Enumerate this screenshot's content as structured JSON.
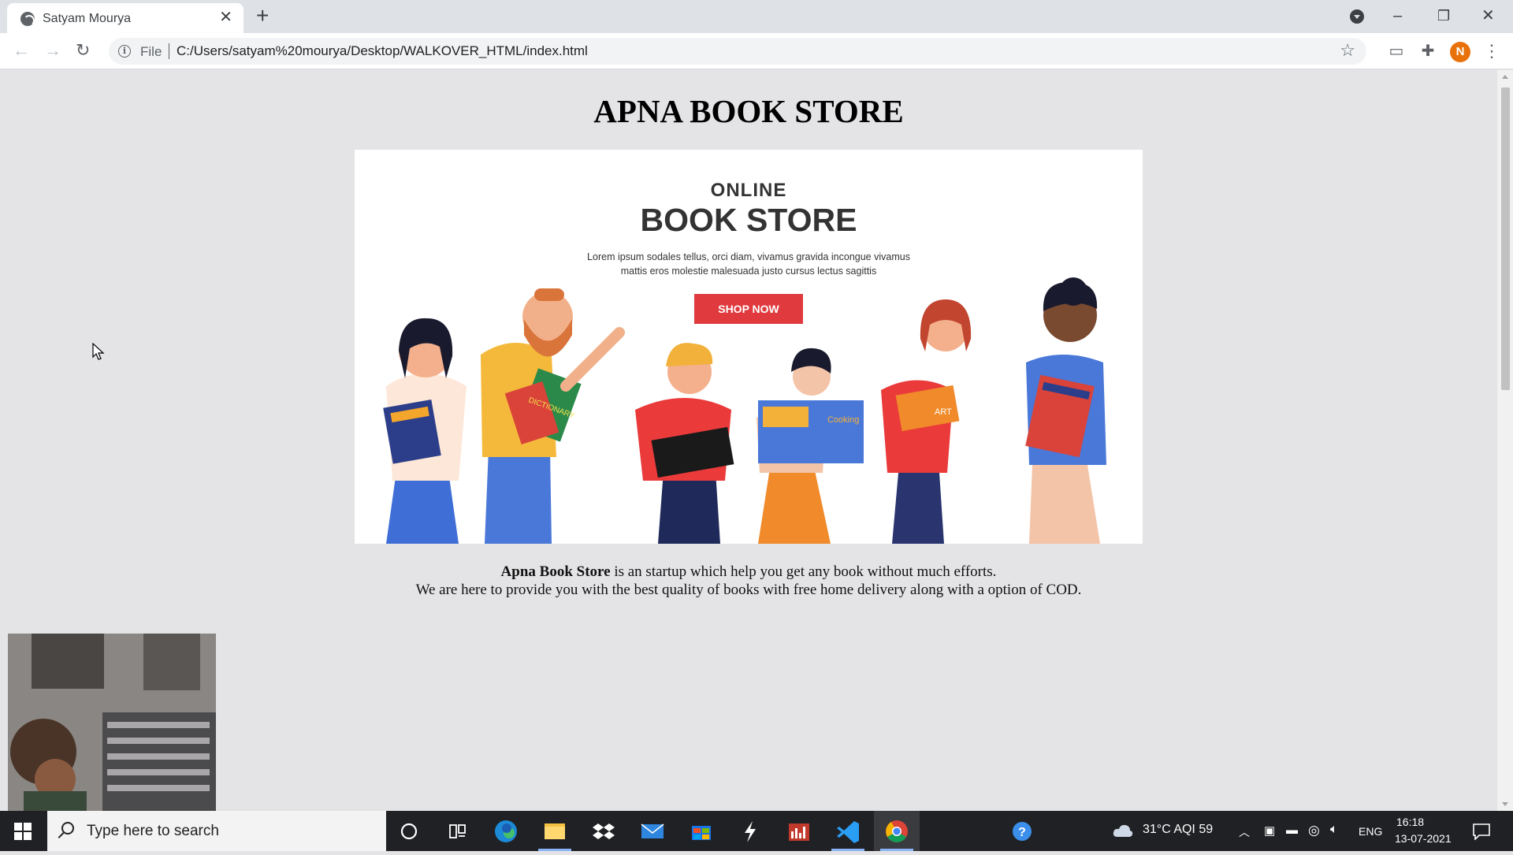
{
  "browser": {
    "tab_title": "Satyam Mourya",
    "url_scheme": "File",
    "url": "C:/Users/satyam%20mourya/Desktop/WALKOVER_HTML/index.html",
    "profile_initial": "N"
  },
  "page": {
    "heading": "APNA BOOK STORE",
    "banner": {
      "kicker": "ONLINE",
      "title": "BOOK STORE",
      "lorem_line1": "Lorem ipsum sodales tellus, orci diam, vivamus gravida incongue vivamus",
      "lorem_line2": "mattis eros molestie malesuada justo cursus lectus sagittis",
      "shop_button": "SHOP NOW",
      "book_labels": [
        "DICTIONARY",
        "Cooking",
        "ART"
      ]
    },
    "description": {
      "brand": "Apna Book Store",
      "line1_rest": " is an startup which help you get any book without much efforts.",
      "line2": "We are here to provide you with the best quality of books with free home delivery along with a option of COD."
    }
  },
  "taskbar": {
    "search_placeholder": "Type here to search",
    "weather": "31°C  AQI 59",
    "language": "ENG",
    "time": "16:18",
    "date": "13-07-2021"
  }
}
